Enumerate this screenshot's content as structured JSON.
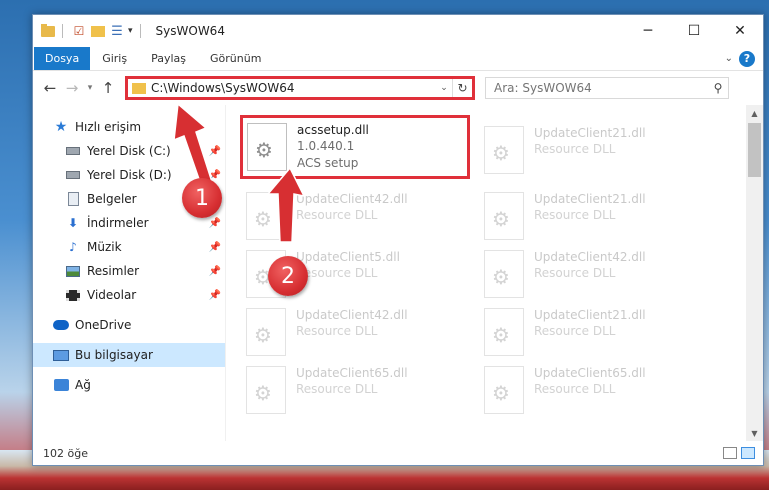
{
  "window": {
    "title": "SysWOW64",
    "controls": {
      "minimize": "─",
      "maximize": "☐",
      "close": "✕"
    }
  },
  "ribbon": {
    "tabs": [
      "Dosya",
      "Giriş",
      "Paylaş",
      "Görünüm"
    ],
    "help": "?"
  },
  "navbar": {
    "address": "C:\\Windows\\SysWOW64",
    "search_placeholder": "Ara: SysWOW64"
  },
  "nav_pane": {
    "items": [
      {
        "label": "Hızlı erişim",
        "icon": "star-icon"
      },
      {
        "label": "Yerel Disk (C:)",
        "icon": "drive-icon",
        "pinned": true
      },
      {
        "label": "Yerel Disk (D:)",
        "icon": "drive-icon",
        "pinned": true
      },
      {
        "label": "Belgeler",
        "icon": "documents-icon",
        "pinned": true
      },
      {
        "label": "İndirmeler",
        "icon": "download-icon",
        "pinned": true
      },
      {
        "label": "Müzik",
        "icon": "music-icon",
        "pinned": true
      },
      {
        "label": "Resimler",
        "icon": "pictures-icon",
        "pinned": true
      },
      {
        "label": "Videolar",
        "icon": "videos-icon",
        "pinned": true
      },
      {
        "label": "OneDrive",
        "icon": "onedrive-icon"
      },
      {
        "label": "Bu bilgisayar",
        "icon": "computer-icon",
        "selected": true
      },
      {
        "label": "Ağ",
        "icon": "network-icon"
      }
    ]
  },
  "files": [
    {
      "name": "acssetup.dll",
      "line2": "1.0.440.1",
      "line3": "ACS setup",
      "highlighted": true
    },
    {
      "name": "UpdateClient21.dll",
      "line2": "Resource DLL"
    },
    {
      "name": "UpdateClient42.dll",
      "line2": "Resource DLL"
    },
    {
      "name": "UpdateClient21.dll",
      "line2": "Resource DLL"
    },
    {
      "name": "UpdateClient5.dll",
      "line2": "Resource DLL"
    },
    {
      "name": "UpdateClient42.dll",
      "line2": "Resource DLL"
    },
    {
      "name": "UpdateClient42.dll",
      "line2": "Resource DLL"
    },
    {
      "name": "UpdateClient21.dll",
      "line2": "Resource DLL"
    },
    {
      "name": "UpdateClient65.dll",
      "line2": "Resource DLL"
    },
    {
      "name": "UpdateClient65.dll",
      "line2": "Resource DLL"
    }
  ],
  "status": {
    "count": "102 öğe"
  },
  "annotations": {
    "step1": "1",
    "step2": "2"
  },
  "colors": {
    "accent": "#1979ca",
    "highlight": "#e0303a"
  }
}
